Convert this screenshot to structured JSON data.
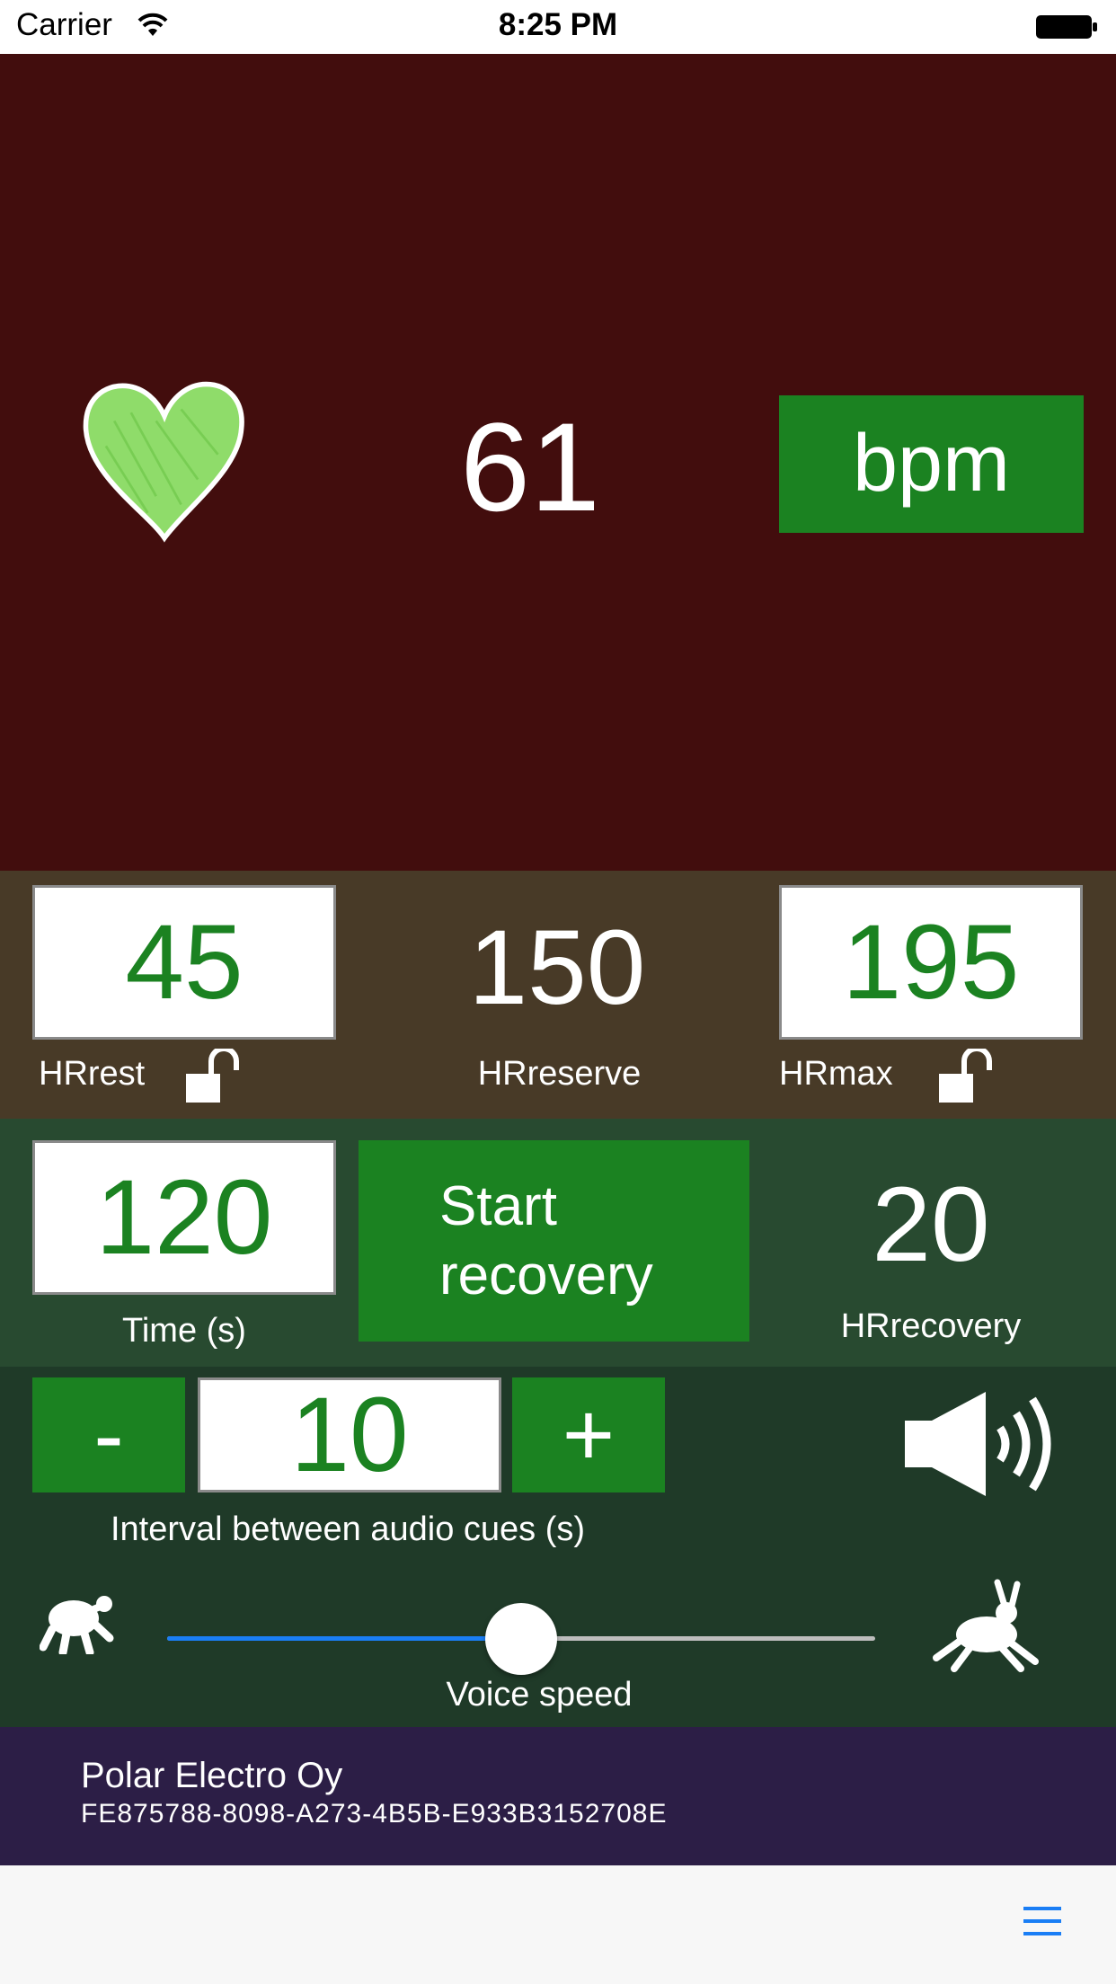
{
  "status_bar": {
    "carrier": "Carrier",
    "time": "8:25 PM"
  },
  "heart_rate": {
    "value": "61",
    "unit_button": "bpm",
    "heart_icon": "heart-icon"
  },
  "zones": {
    "hr_rest": {
      "value": "45",
      "label": "HRrest"
    },
    "hr_reserve": {
      "value": "150",
      "label": "HRreserve"
    },
    "hr_max": {
      "value": "195",
      "label": "HRmax"
    }
  },
  "recovery": {
    "time": {
      "value": "120",
      "label": "Time (s)"
    },
    "start_button": {
      "line1": "Start",
      "line2": "recovery"
    },
    "hr_recovery": {
      "value": "20",
      "label": "HRrecovery"
    }
  },
  "audio": {
    "minus_label": "-",
    "interval_value": "10",
    "plus_label": "+",
    "interval_caption": "Interval between audio cues (s)",
    "voice_speed_label": "Voice speed",
    "voice_speed_fraction": 0.5
  },
  "device": {
    "name": "Polar Electro Oy",
    "id": "FE875788-8098-A273-4B5B-E933B3152708E"
  },
  "toolbar": {
    "menu_icon": "hamburger-menu-icon"
  },
  "colors": {
    "hr_background": "#420d0d",
    "zones_background": "#483a27",
    "recovery_background": "#284a30",
    "audio_background": "#1f3a28",
    "device_background": "#2c1e46",
    "accent_green": "#1b8221",
    "slider_blue": "#1a7ef5"
  }
}
